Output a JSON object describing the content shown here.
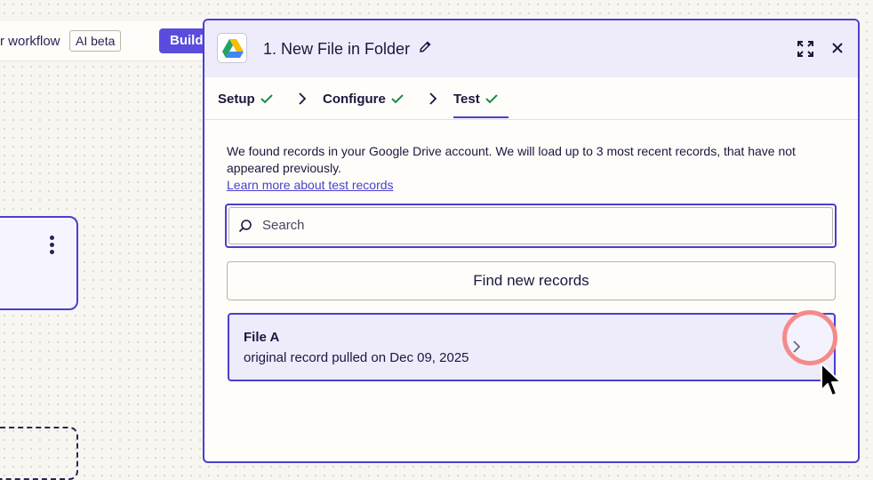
{
  "topbar": {
    "workflow_text": "r workflow",
    "ai_badge": "AI beta",
    "build_button": "Build"
  },
  "panel": {
    "app_icon": "google-drive-icon",
    "title": "1. New File in Folder",
    "tabs": [
      {
        "label": "Setup",
        "status": "complete"
      },
      {
        "label": "Configure",
        "status": "complete"
      },
      {
        "label": "Test",
        "status": "complete",
        "active": true
      }
    ],
    "description": "We found records in your Google Drive account. We will load up to 3 most recent records, that have not appeared previously.",
    "learn_more": "Learn more about test records",
    "search_placeholder": "Search",
    "find_button": "Find new records",
    "records": [
      {
        "name": "File A",
        "subtitle": "original record pulled on Dec 09, 2025"
      }
    ]
  },
  "colors": {
    "accent": "#4a3fcf",
    "build_button": "#5a4dde",
    "success": "#1f8a4c",
    "highlight_ring": "#f58a8a"
  }
}
